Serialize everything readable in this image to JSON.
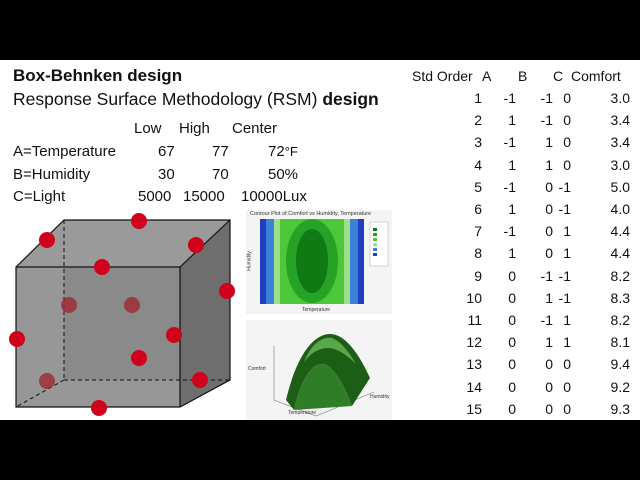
{
  "title_line1": "Box-Behnken design",
  "title_line2_prefix": "Response Surface Methodology (RSM) ",
  "title_line2_bold": "design",
  "factor_headers": [
    "Low",
    "High",
    "Center"
  ],
  "factors": [
    {
      "label": "A=Temperature",
      "low": "67",
      "high": "77",
      "center": "72",
      "unit": "°F"
    },
    {
      "label": "B=Humidity",
      "low": "30",
      "high": "70",
      "center": "50%",
      "unit": ""
    },
    {
      "label": "C=Light",
      "low": "5000",
      "high": "15000",
      "center": "10000",
      "unit": "Lux"
    }
  ],
  "contour_plot": {
    "title": "Contour Plot of Comfort vs Humidity, Temperature",
    "xlabel": "Temperature",
    "ylabel": "Humidity"
  },
  "surface_plot": {
    "zlabel": "Comfort",
    "xlabel": "Temperature",
    "ylabel": "Humidity"
  },
  "table": {
    "headers": [
      "Std Order",
      "A",
      "B",
      "C",
      "Comfort"
    ],
    "rows": [
      [
        "1",
        "-1",
        "-1",
        "0",
        "3.0"
      ],
      [
        "2",
        "1",
        "-1",
        "0",
        "3.4"
      ],
      [
        "3",
        "-1",
        "1",
        "0",
        "3.4"
      ],
      [
        "4",
        "1",
        "1",
        "0",
        "3.0"
      ],
      [
        "5",
        "-1",
        "0",
        "-1",
        "5.0"
      ],
      [
        "6",
        "1",
        "0",
        "-1",
        "4.0"
      ],
      [
        "7",
        "-1",
        "0",
        "1",
        "4.4"
      ],
      [
        "8",
        "1",
        "0",
        "1",
        "4.4"
      ],
      [
        "9",
        "0",
        "-1",
        "-1",
        "8.2"
      ],
      [
        "10",
        "0",
        "1",
        "-1",
        "8.3"
      ],
      [
        "11",
        "0",
        "-1",
        "1",
        "8.2"
      ],
      [
        "12",
        "0",
        "1",
        "1",
        "8.1"
      ],
      [
        "13",
        "0",
        "0",
        "0",
        "9.4"
      ],
      [
        "14",
        "0",
        "0",
        "0",
        "9.2"
      ],
      [
        "15",
        "0",
        "0",
        "0",
        "9.3"
      ]
    ]
  }
}
